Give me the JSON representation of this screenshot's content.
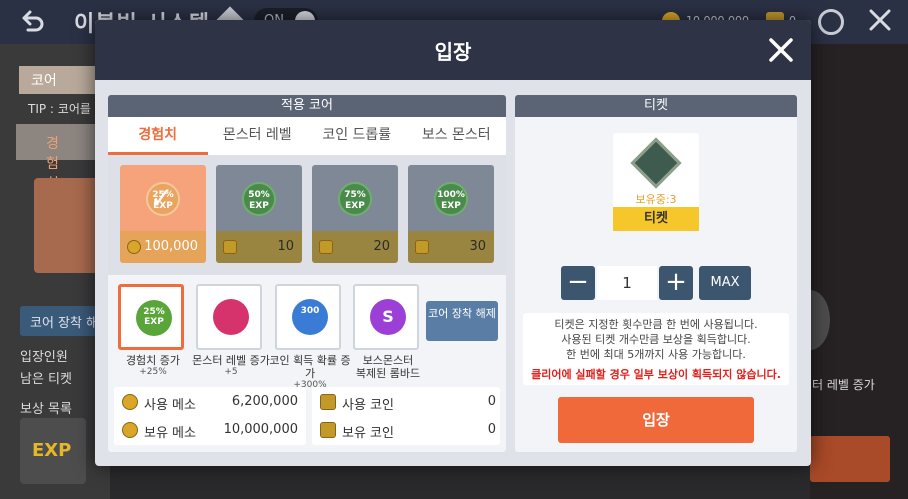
{
  "background": {
    "title": "이볼빙 시스템",
    "toggle": "ON",
    "coin_amount": "10,000,000",
    "box_amount": "0",
    "core_tab": "코어",
    "tip": "TIP : 코어를",
    "exp_tab": "경험치",
    "equip_button": "코어 장착 해",
    "entry_count_label": "입장인원",
    "remaining_ticket_label": "남은 티켓",
    "reward_list_label": "보상 목록",
    "reward_exp": "EXP",
    "monster_level_label": "터 레벨 증가"
  },
  "modal": {
    "title": "입장",
    "core_panel": {
      "header": "적용 코어",
      "tabs": [
        "경험치",
        "몬스터 레벨",
        "코인 드롭률",
        "보스 몬스터"
      ],
      "cores": [
        {
          "badge": "25% EXP",
          "cost": "100,000",
          "currency": "coin",
          "selected": true
        },
        {
          "badge": "50% EXP",
          "cost": "10",
          "currency": "box",
          "selected": false
        },
        {
          "badge": "75% EXP",
          "cost": "20",
          "currency": "box",
          "selected": false
        },
        {
          "badge": "100% EXP",
          "cost": "30",
          "currency": "box",
          "selected": false
        }
      ],
      "equipped": [
        {
          "icon": "25% EXP",
          "label": "경험치 증가",
          "sub": "+25%",
          "color": "#5aa53a"
        },
        {
          "icon": "",
          "label": "몬스터 레벨 증가",
          "sub": "+5",
          "color": "#d6336c"
        },
        {
          "icon": "300",
          "label": "코인 획득 확률 증가",
          "sub": "+300%",
          "color": "#3a7bd5"
        },
        {
          "icon": "S",
          "label": "보스몬스터",
          "sub": "복제된 롬바드",
          "color": "#9b3fd6"
        }
      ],
      "unequip_button": "코어 장착 해제",
      "meso": {
        "used_label": "사용 메소",
        "used_value": "6,200,000",
        "owned_label": "보유 메소",
        "owned_value": "10,000,000"
      },
      "coin": {
        "used_label": "사용 코인",
        "used_value": "0",
        "owned_label": "보유 코인",
        "owned_value": "0"
      }
    },
    "ticket_panel": {
      "header": "티켓",
      "owned_text": "보유중:3",
      "ticket_name": "티켓",
      "quantity": "1",
      "max_label": "MAX",
      "info_lines": [
        "티켓은 지정한 횟수만큼 한 번에 사용됩니다.",
        "사용된 티켓 개수만큼 보상을 획득합니다.",
        "한 번에 최대 5개까지 사용 가능합니다."
      ],
      "warning": "클리어에 실패할 경우 일부 보상이 획득되지 않습니다.",
      "enter_button": "입장"
    }
  }
}
